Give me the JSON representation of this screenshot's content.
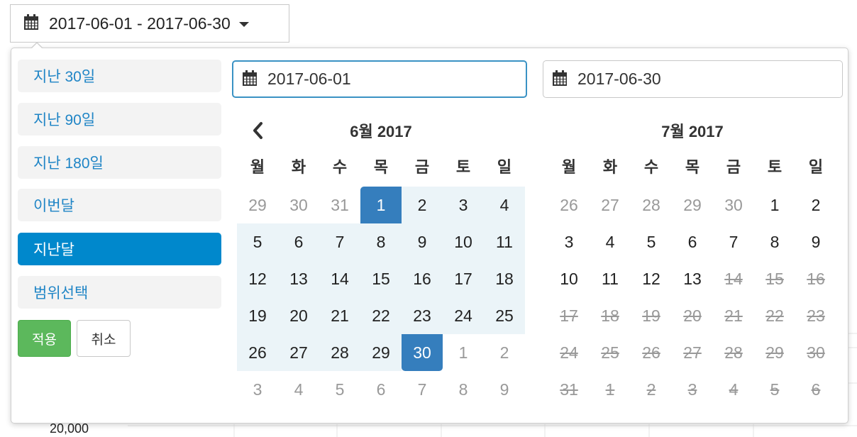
{
  "trigger": {
    "value": "2017-06-01 - 2017-06-30"
  },
  "background": {
    "axis_label": "20,000"
  },
  "presets": [
    {
      "label": "지난 30일",
      "active": false
    },
    {
      "label": "지난 90일",
      "active": false
    },
    {
      "label": "지난 180일",
      "active": false
    },
    {
      "label": "이번달",
      "active": false
    },
    {
      "label": "지난달",
      "active": true
    },
    {
      "label": "범위선택",
      "active": false
    }
  ],
  "buttons": {
    "apply": "적용",
    "cancel": "취소"
  },
  "start_input": {
    "value": "2017-06-01"
  },
  "end_input": {
    "value": "2017-06-30"
  },
  "weekdays": [
    "월",
    "화",
    "수",
    "목",
    "금",
    "토",
    "일"
  ],
  "calendars": [
    {
      "title": "6월 2017",
      "has_prev": true,
      "weeks": [
        [
          {
            "d": "29",
            "s": "off"
          },
          {
            "d": "30",
            "s": "off"
          },
          {
            "d": "31",
            "s": "off"
          },
          {
            "d": "1",
            "s": "start"
          },
          {
            "d": "2",
            "s": "range"
          },
          {
            "d": "3",
            "s": "range"
          },
          {
            "d": "4",
            "s": "range"
          }
        ],
        [
          {
            "d": "5",
            "s": "range"
          },
          {
            "d": "6",
            "s": "range"
          },
          {
            "d": "7",
            "s": "range"
          },
          {
            "d": "8",
            "s": "range"
          },
          {
            "d": "9",
            "s": "range"
          },
          {
            "d": "10",
            "s": "range"
          },
          {
            "d": "11",
            "s": "range"
          }
        ],
        [
          {
            "d": "12",
            "s": "range"
          },
          {
            "d": "13",
            "s": "range"
          },
          {
            "d": "14",
            "s": "range"
          },
          {
            "d": "15",
            "s": "range"
          },
          {
            "d": "16",
            "s": "range"
          },
          {
            "d": "17",
            "s": "range"
          },
          {
            "d": "18",
            "s": "range"
          }
        ],
        [
          {
            "d": "19",
            "s": "range"
          },
          {
            "d": "20",
            "s": "range"
          },
          {
            "d": "21",
            "s": "range"
          },
          {
            "d": "22",
            "s": "range"
          },
          {
            "d": "23",
            "s": "range"
          },
          {
            "d": "24",
            "s": "range"
          },
          {
            "d": "25",
            "s": "range"
          }
        ],
        [
          {
            "d": "26",
            "s": "range"
          },
          {
            "d": "27",
            "s": "range"
          },
          {
            "d": "28",
            "s": "range"
          },
          {
            "d": "29",
            "s": "range"
          },
          {
            "d": "30",
            "s": "end"
          },
          {
            "d": "1",
            "s": "off"
          },
          {
            "d": "2",
            "s": "off"
          }
        ],
        [
          {
            "d": "3",
            "s": "off"
          },
          {
            "d": "4",
            "s": "off"
          },
          {
            "d": "5",
            "s": "off"
          },
          {
            "d": "6",
            "s": "off"
          },
          {
            "d": "7",
            "s": "off"
          },
          {
            "d": "8",
            "s": "off"
          },
          {
            "d": "9",
            "s": "off"
          }
        ]
      ]
    },
    {
      "title": "7월 2017",
      "has_prev": false,
      "weeks": [
        [
          {
            "d": "26",
            "s": "off"
          },
          {
            "d": "27",
            "s": "off"
          },
          {
            "d": "28",
            "s": "off"
          },
          {
            "d": "29",
            "s": "off"
          },
          {
            "d": "30",
            "s": "off"
          },
          {
            "d": "1",
            "s": "normal"
          },
          {
            "d": "2",
            "s": "normal"
          }
        ],
        [
          {
            "d": "3",
            "s": "normal"
          },
          {
            "d": "4",
            "s": "normal"
          },
          {
            "d": "5",
            "s": "normal"
          },
          {
            "d": "6",
            "s": "normal"
          },
          {
            "d": "7",
            "s": "normal"
          },
          {
            "d": "8",
            "s": "normal"
          },
          {
            "d": "9",
            "s": "normal"
          }
        ],
        [
          {
            "d": "10",
            "s": "normal"
          },
          {
            "d": "11",
            "s": "normal"
          },
          {
            "d": "12",
            "s": "normal"
          },
          {
            "d": "13",
            "s": "normal"
          },
          {
            "d": "14",
            "s": "disabled"
          },
          {
            "d": "15",
            "s": "disabled"
          },
          {
            "d": "16",
            "s": "disabled"
          }
        ],
        [
          {
            "d": "17",
            "s": "disabled"
          },
          {
            "d": "18",
            "s": "disabled"
          },
          {
            "d": "19",
            "s": "disabled"
          },
          {
            "d": "20",
            "s": "disabled"
          },
          {
            "d": "21",
            "s": "disabled"
          },
          {
            "d": "22",
            "s": "disabled"
          },
          {
            "d": "23",
            "s": "disabled"
          }
        ],
        [
          {
            "d": "24",
            "s": "disabled"
          },
          {
            "d": "25",
            "s": "disabled"
          },
          {
            "d": "26",
            "s": "disabled"
          },
          {
            "d": "27",
            "s": "disabled"
          },
          {
            "d": "28",
            "s": "disabled"
          },
          {
            "d": "29",
            "s": "disabled"
          },
          {
            "d": "30",
            "s": "disabled"
          }
        ],
        [
          {
            "d": "31",
            "s": "disabled"
          },
          {
            "d": "1",
            "s": "disabled"
          },
          {
            "d": "2",
            "s": "disabled"
          },
          {
            "d": "3",
            "s": "disabled"
          },
          {
            "d": "4",
            "s": "disabled"
          },
          {
            "d": "5",
            "s": "disabled"
          },
          {
            "d": "6",
            "s": "disabled"
          }
        ]
      ]
    }
  ],
  "colors": {
    "accent_blue": "#0088cc",
    "selected_day": "#357ebd",
    "range_bg": "#ebf4f8",
    "apply_green": "#5cb85c",
    "preset_text": "#1f85c6"
  },
  "icons": {
    "trigger": "calendar-icon",
    "inputs": "calendar-icon",
    "prev": "chevron-left-icon",
    "dropdown": "caret-down-icon"
  }
}
